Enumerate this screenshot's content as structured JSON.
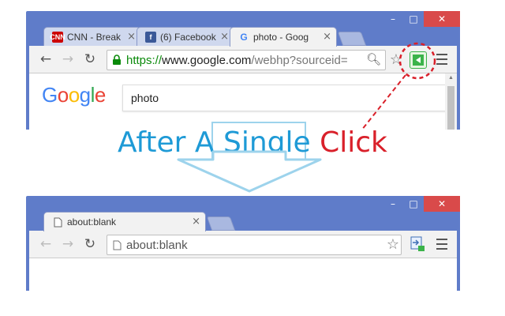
{
  "colors": {
    "window_frame": "#5f7cc9",
    "close_button": "#d94a4a",
    "caption_blue": "#1e9ad6",
    "caption_red": "#d9202a",
    "callout_red": "#d9202a",
    "extension_green": "#3bb34a",
    "arrow_outline": "#9dd3ec"
  },
  "window_controls": {
    "minimize": "–",
    "maximize": "□",
    "close": "✕"
  },
  "before": {
    "tabs": [
      {
        "favicon": "cnn-favicon",
        "favicon_text": "CNN",
        "label": "CNN - Break",
        "active": false
      },
      {
        "favicon": "facebook-favicon",
        "favicon_text": "f",
        "label": "(6) Facebook",
        "active": false
      },
      {
        "favicon": "google-favicon",
        "favicon_text": "G",
        "label": "photo - Goog",
        "active": true
      }
    ],
    "toolbar": {
      "back": "←",
      "forward": "→",
      "reload": "↻",
      "url_scheme": "https://",
      "url_host": "www.google.com",
      "url_path": "/webhp?sourceid=",
      "star": "☆",
      "extension_icon": "green-arrow-extension-icon"
    },
    "page": {
      "logo_letters": [
        {
          "ch": "G",
          "color": "#4285f4"
        },
        {
          "ch": "o",
          "color": "#ea4335"
        },
        {
          "ch": "o",
          "color": "#fbbc05"
        },
        {
          "ch": "g",
          "color": "#4285f4"
        },
        {
          "ch": "l",
          "color": "#34a853"
        },
        {
          "ch": "e",
          "color": "#ea4335"
        }
      ],
      "search_value": "photo"
    }
  },
  "caption": {
    "part1": "After A ",
    "part2": "Single",
    "part3": " Click"
  },
  "after": {
    "tabs": [
      {
        "favicon": "page-favicon",
        "label": "about:blank",
        "active": true
      }
    ],
    "toolbar": {
      "back": "←",
      "forward": "→",
      "reload": "↻",
      "url": "about:blank",
      "star": "☆",
      "extension_icon": "extension-icon-alt"
    }
  }
}
